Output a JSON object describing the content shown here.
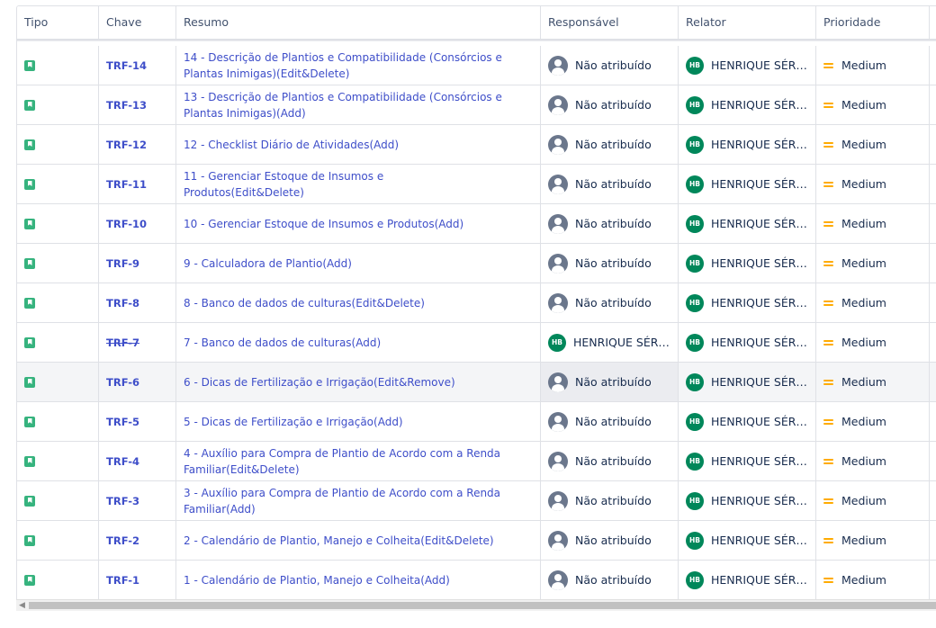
{
  "headers": {
    "tipo": "Tipo",
    "chave": "Chave",
    "resumo": "Resumo",
    "responsavel": "Responsável",
    "relator": "Relator",
    "prioridade": "Prioridade"
  },
  "colors": {
    "link": "#3e4ec9",
    "story_icon": "#36b37e",
    "avatar": "#00875a",
    "priority_medium": "#ffab00"
  },
  "rows": [
    {
      "key": "TRF-14",
      "summary": "14 - Descrição de Plantios e Compatibilidade (Consórcios e Plantas Inimigas)(Edit&Delete)",
      "assignee": "Não atribuído",
      "reporter": "HENRIQUE SÉRGI…",
      "priority": "Medium"
    },
    {
      "key": "TRF-13",
      "summary": "13 - Descrição de Plantios e Compatibilidade (Consórcios e Plantas Inimigas)(Add)",
      "assignee": "Não atribuído",
      "reporter": "HENRIQUE SÉRGI…",
      "priority": "Medium"
    },
    {
      "key": "TRF-12",
      "summary": "12 - Checklist Diário de Atividades(Add)",
      "assignee": "Não atribuído",
      "reporter": "HENRIQUE SÉRGI…",
      "priority": "Medium"
    },
    {
      "key": "TRF-11",
      "summary": "11 - Gerenciar Estoque de Insumos e Produtos(Edit&Delete)",
      "assignee": "Não atribuído",
      "reporter": "HENRIQUE SÉRGI…",
      "priority": "Medium"
    },
    {
      "key": "TRF-10",
      "summary": "10 - Gerenciar Estoque de Insumos e Produtos(Add)",
      "assignee": "Não atribuído",
      "reporter": "HENRIQUE SÉRGI…",
      "priority": "Medium"
    },
    {
      "key": "TRF-9",
      "summary": "9 - Calculadora de Plantio(Add)",
      "assignee": "Não atribuído",
      "reporter": "HENRIQUE SÉRGI…",
      "priority": "Medium"
    },
    {
      "key": "TRF-8",
      "summary": "8 - Banco de dados de culturas(Edit&Delete)",
      "assignee": "Não atribuído",
      "reporter": "HENRIQUE SÉRGI…",
      "priority": "Medium"
    },
    {
      "key": "TRF-7",
      "summary": "7 - Banco de dados de culturas(Add)",
      "assignee": "HENRIQUE SÉRGI…",
      "reporter": "HENRIQUE SÉRGI…",
      "priority": "Medium",
      "done": true,
      "assigned": true
    },
    {
      "key": "TRF-6",
      "summary": "6 - Dicas de Fertilização e Irrigação(Edit&Remove)",
      "assignee": "Não atribuído",
      "reporter": "HENRIQUE SÉRGI…",
      "priority": "Medium",
      "selected": true
    },
    {
      "key": "TRF-5",
      "summary": "5 - Dicas de Fertilização e Irrigação(Add)",
      "assignee": "Não atribuído",
      "reporter": "HENRIQUE SÉRGI…",
      "priority": "Medium"
    },
    {
      "key": "TRF-4",
      "summary": "4 - Auxílio para Compra de Plantio de Acordo com a Renda Familiar(Edit&Delete)",
      "assignee": "Não atribuído",
      "reporter": "HENRIQUE SÉRGI…",
      "priority": "Medium"
    },
    {
      "key": "TRF-3",
      "summary": "3 - Auxílio para Compra de Plantio de Acordo com a Renda Familiar(Add)",
      "assignee": "Não atribuído",
      "reporter": "HENRIQUE SÉRGI…",
      "priority": "Medium"
    },
    {
      "key": "TRF-2",
      "summary": "2 - Calendário de Plantio, Manejo e Colheita(Edit&Delete)",
      "assignee": "Não atribuído",
      "reporter": "HENRIQUE SÉRGI…",
      "priority": "Medium"
    },
    {
      "key": "TRF-1",
      "summary": "1 - Calendário de Plantio, Manejo e Colheita(Add)",
      "assignee": "Não atribuído",
      "reporter": "HENRIQUE SÉRGI…",
      "priority": "Medium"
    }
  ],
  "avatar_initials": "HB"
}
